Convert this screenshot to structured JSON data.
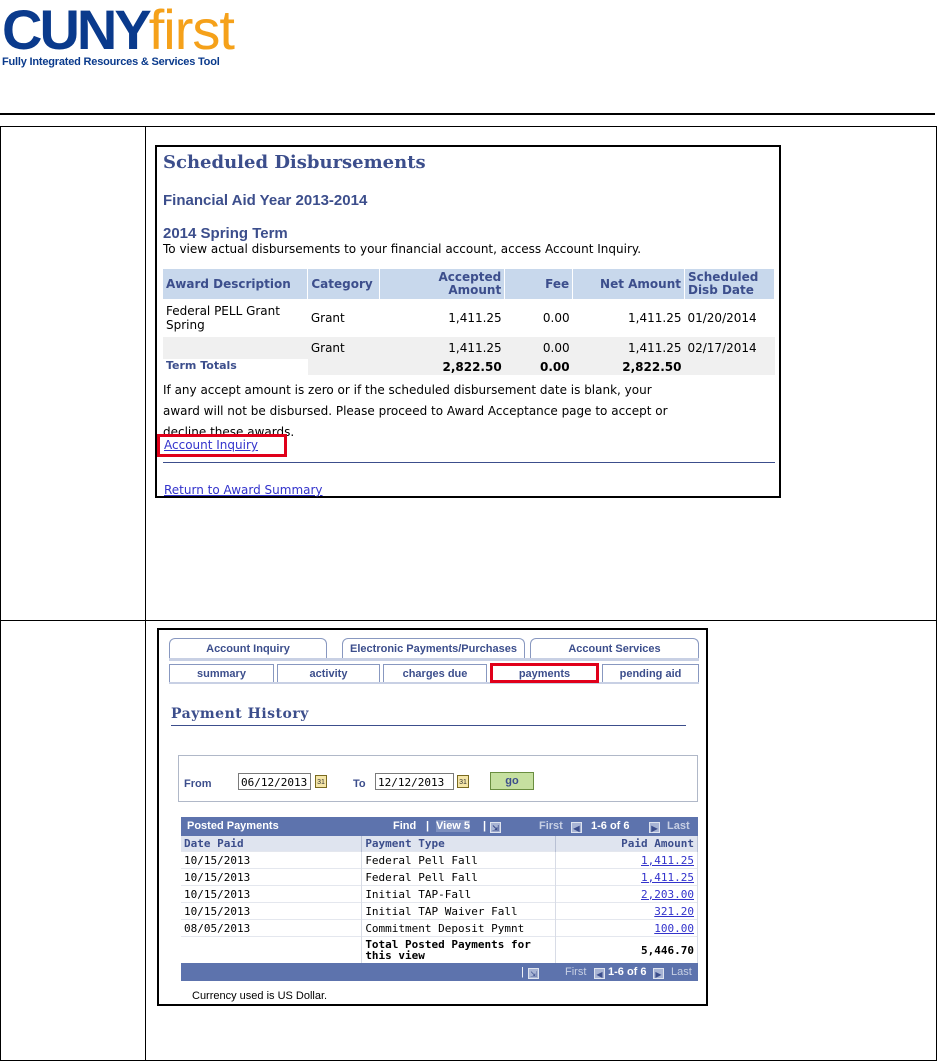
{
  "logo": {
    "cuny": "CUNY",
    "first": "first",
    "tagline": "Fully Integrated Resources & Services Tool"
  },
  "disbursements": {
    "title": "Scheduled Disbursements",
    "aid_year": "Financial Aid Year 2013-2014",
    "term": "2014 Spring Term",
    "note": "To view actual disbursements to your financial account, access Account Inquiry.",
    "columns": [
      "Award Description",
      "Category",
      "Accepted Amount",
      "Fee",
      "Net Amount",
      "Scheduled Disb Date"
    ],
    "rows": [
      {
        "desc": "Federal PELL Grant Spring",
        "category": "Grant",
        "accepted": "1,411.25",
        "fee": "0.00",
        "net": "1,411.25",
        "date": "01/20/2014"
      },
      {
        "desc": "",
        "category": "Grant",
        "accepted": "1,411.25",
        "fee": "0.00",
        "net": "1,411.25",
        "date": "02/17/2014"
      }
    ],
    "totals": {
      "label": "Term Totals",
      "accepted": "2,822.50",
      "fee": "0.00",
      "net": "2,822.50"
    },
    "warning": "If any accept amount is zero or if the scheduled disbursement date is blank, your award will not be disbursed. Please proceed to Award Acceptance page to accept or decline these awards.",
    "account_inquiry_link": "Account Inquiry",
    "return_link": "Return to Award Summary"
  },
  "payments": {
    "tabs": [
      "Account Inquiry",
      "Electronic Payments/Purchases",
      "Account Services"
    ],
    "subtabs": [
      "summary",
      "activity",
      "charges due",
      "payments",
      "pending aid"
    ],
    "title": "Payment History",
    "from_label": "From",
    "from_value": "06/12/2013",
    "to_label": "To",
    "to_value": "12/12/2013",
    "go_label": "go",
    "grid_title": "Posted Payments",
    "find": "Find",
    "view": "View 5",
    "first": "First",
    "range": "1-6 of 6",
    "last": "Last",
    "columns": [
      "Date Paid",
      "Payment Type",
      "Paid Amount"
    ],
    "rows": [
      {
        "date": "10/15/2013",
        "type": "Federal Pell Fall",
        "amount": "1,411.25"
      },
      {
        "date": "10/15/2013",
        "type": "Federal Pell Fall",
        "amount": "1,411.25"
      },
      {
        "date": "10/15/2013",
        "type": "Initial TAP-Fall",
        "amount": "2,203.00"
      },
      {
        "date": "10/15/2013",
        "type": "Initial TAP Waiver Fall",
        "amount": "321.20"
      },
      {
        "date": "08/05/2013",
        "type": "Commitment Deposit Pymnt",
        "amount": "100.00"
      }
    ],
    "total_label": "Total Posted Payments for this view",
    "total_value": "5,446.70",
    "currency": "Currency used is US Dollar."
  }
}
